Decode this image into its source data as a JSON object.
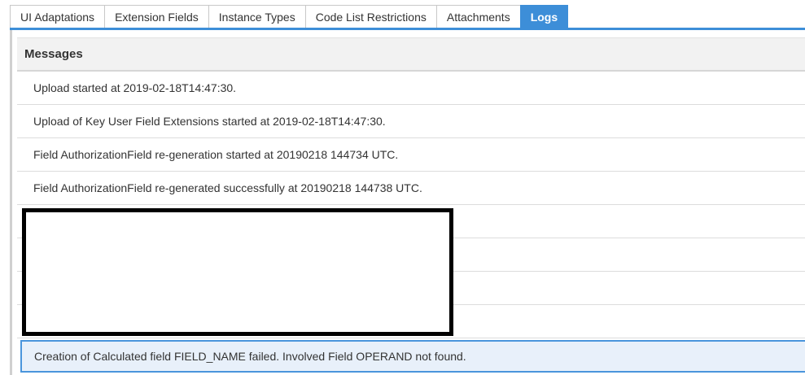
{
  "tabs": [
    {
      "label": "UI Adaptations",
      "active": false
    },
    {
      "label": "Extension Fields",
      "active": false
    },
    {
      "label": "Instance Types",
      "active": false
    },
    {
      "label": "Code List Restrictions",
      "active": false
    },
    {
      "label": "Attachments",
      "active": false
    },
    {
      "label": "Logs",
      "active": true
    }
  ],
  "messages": {
    "header": "Messages",
    "rows": [
      "Upload started at 2019-02-18T14:47:30.",
      "Upload of Key User Field Extensions started at 2019-02-18T14:47:30.",
      "Field AuthorizationField re-generation started at 20190218 144734 UTC.",
      "Field AuthorizationField re-generated successfully at 20190218 144738 UTC.",
      "",
      "",
      "",
      ""
    ],
    "selected_row": "Creation of Calculated field FIELD_NAME failed. Involved Field OPERAND not found."
  },
  "colors": {
    "accent": "#3d8ed8",
    "selected_row_bg": "#e8f0fa",
    "header_bg": "#f2f2f2"
  }
}
